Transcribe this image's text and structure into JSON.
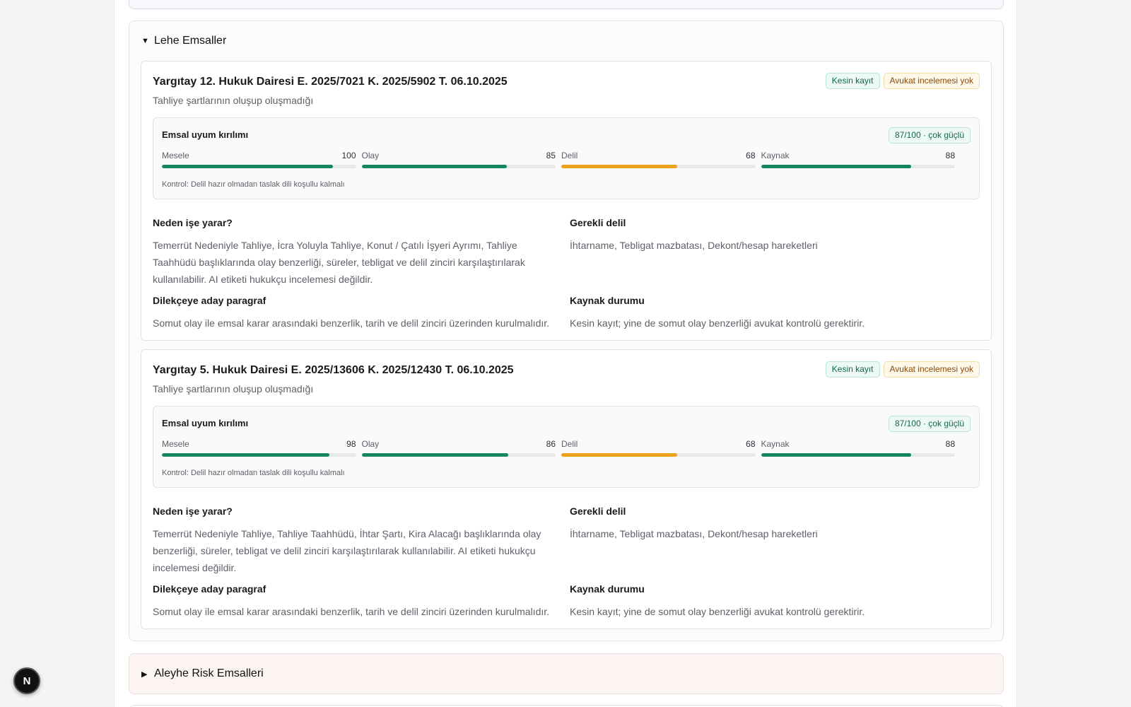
{
  "lehe_section": {
    "title": "Lehe Emsaller",
    "cases": [
      {
        "title": "Yargıtay 12. Hukuk Dairesi E. 2025/7021 K. 2025/5902 T. 06.10.2025",
        "subtitle": "Tahliye şartlarının oluşup oluşmadığı",
        "badge_record": "Kesin kayıt",
        "badge_review": "Avukat incelemesi yok",
        "score_title": "Emsal uyum kırılımı",
        "score_badge": "87/100 · çok güçlü",
        "metrics": [
          {
            "label": "Mesele",
            "value": 100,
            "color": "green"
          },
          {
            "label": "Olay",
            "value": 85,
            "color": "green"
          },
          {
            "label": "Delil",
            "value": 68,
            "color": "orange"
          },
          {
            "label": "Kaynak",
            "value": 88,
            "color": "green"
          }
        ],
        "score_note": "Kontrol: Delil hazır olmadan taslak dili koşullu kalmalı",
        "why_title": "Neden işe yarar?",
        "why_text": "Temerrüt Nedeniyle Tahliye, İcra Yoluyla Tahliye, Konut / Çatılı İşyeri Ayrımı, Tahliye Taahhüdü başlıklarında olay benzerliği, süreler, tebligat ve delil zinciri karşılaştırılarak kullanılabilir. AI etiketi hukukçu incelemesi değildir.",
        "evidence_title": "Gerekli delil",
        "evidence_text": "İhtarname, Tebligat mazbatası, Dekont/hesap hareketleri",
        "paragraph_title": "Dilekçeye aday paragraf",
        "paragraph_text": "Somut olay ile emsal karar arasındaki benzerlik, tarih ve delil zinciri üzerinden kurulmalıdır.",
        "source_title": "Kaynak durumu",
        "source_text": "Kesin kayıt; yine de somut olay benzerliği avukat kontrolü gerektirir."
      },
      {
        "title": "Yargıtay 5. Hukuk Dairesi E. 2025/13606 K. 2025/12430 T. 06.10.2025",
        "subtitle": "Tahliye şartlarının oluşup oluşmadığı",
        "badge_record": "Kesin kayıt",
        "badge_review": "Avukat incelemesi yok",
        "score_title": "Emsal uyum kırılımı",
        "score_badge": "87/100 · çok güçlü",
        "metrics": [
          {
            "label": "Mesele",
            "value": 98,
            "color": "green"
          },
          {
            "label": "Olay",
            "value": 86,
            "color": "green"
          },
          {
            "label": "Delil",
            "value": 68,
            "color": "orange"
          },
          {
            "label": "Kaynak",
            "value": 88,
            "color": "green"
          }
        ],
        "score_note": "Kontrol: Delil hazır olmadan taslak dili koşullu kalmalı",
        "why_title": "Neden işe yarar?",
        "why_text": "Temerrüt Nedeniyle Tahliye, Tahliye Taahhüdü, İhtar Şartı, Kira Alacağı başlıklarında olay benzerliği, süreler, tebligat ve delil zinciri karşılaştırılarak kullanılabilir. AI etiketi hukukçu incelemesi değildir.",
        "evidence_title": "Gerekli delil",
        "evidence_text": "İhtarname, Tebligat mazbatası, Dekont/hesap hareketleri",
        "paragraph_title": "Dilekçeye aday paragraf",
        "paragraph_text": "Somut olay ile emsal karar arasındaki benzerlik, tarih ve delil zinciri üzerinden kurulmalıdır.",
        "source_title": "Kaynak durumu",
        "source_text": "Kesin kayıt; yine de somut olay benzerliği avukat kontrolü gerektirir."
      }
    ]
  },
  "aleyhe_section": {
    "title": "Aleyhe Risk Emsalleri"
  },
  "icons": {
    "expanded": "caret-down-icon",
    "collapsed": "caret-right-icon",
    "fab": "nextjs-logo-icon"
  },
  "fab_letter": "N",
  "colors": {
    "green": "#13875f",
    "orange": "#efa21c"
  }
}
